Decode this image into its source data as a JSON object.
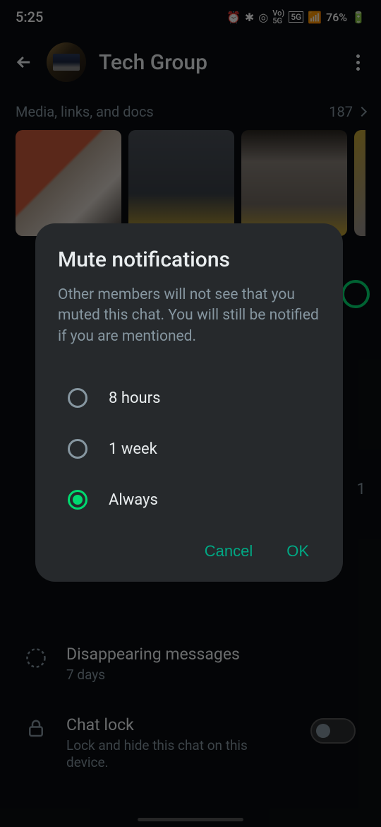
{
  "status": {
    "time": "5:25",
    "battery": "76%"
  },
  "header": {
    "title": "Tech Group"
  },
  "media": {
    "label": "Media, links, and docs",
    "count": "187"
  },
  "dialog": {
    "title": "Mute notifications",
    "description": "Other members will not see that you muted this chat. You will still be notified if you are mentioned.",
    "options": {
      "opt1": "8 hours",
      "opt2": "1 week",
      "opt3": "Always"
    },
    "cancel": "Cancel",
    "ok": "OK"
  },
  "bg": {
    "disappearing_title": "Disappearing messages",
    "disappearing_sub": "7 days",
    "chatlock_title": "Chat lock",
    "chatlock_sub": "Lock and hide this chat on this device.",
    "side_count": "1"
  }
}
